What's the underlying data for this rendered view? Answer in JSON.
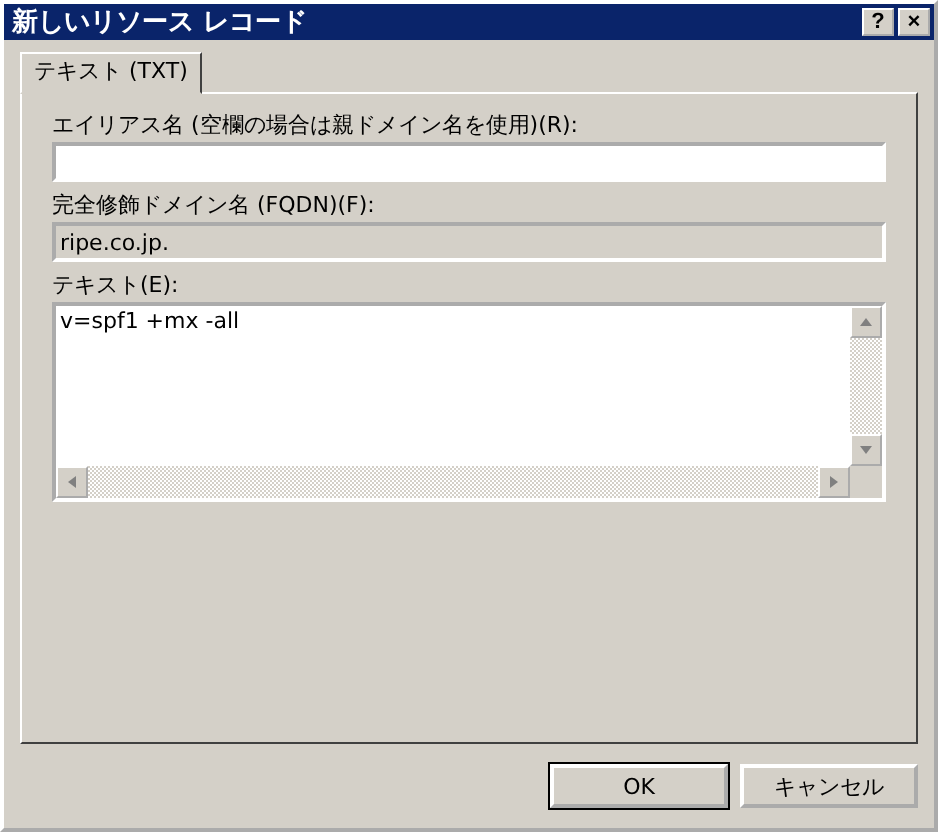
{
  "window": {
    "title": "新しいリソース レコード",
    "help_button": "?",
    "close_button": "×"
  },
  "tabs": [
    {
      "label": "テキスト (TXT)",
      "selected": true
    }
  ],
  "fields": [
    {
      "kind": "input",
      "label": "エイリアス名 (空欄の場合は親ドメイン名を使用)(R):",
      "disabled": false
    },
    {
      "kind": "input",
      "label": "完全修飾ドメイン名 (FQDN)(F):",
      "value": "ripe.co.jp.",
      "disabled": true
    },
    {
      "kind": "textarea",
      "label": "テキスト(E):",
      "value": "v=spf1 +mx -all",
      "disabled": false
    }
  ],
  "buttons": [
    {
      "label": "OK",
      "default": true
    },
    {
      "label": "キャンセル",
      "default": false
    }
  ]
}
